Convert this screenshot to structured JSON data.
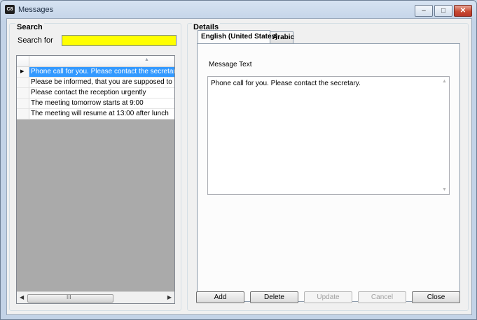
{
  "window": {
    "app_icon_text": "C8",
    "title": "Messages",
    "minimize_glyph": "–",
    "maximize_glyph": "□",
    "close_glyph": "✕"
  },
  "search": {
    "group_label": "Search",
    "field_label": "Search for",
    "value": "",
    "background_color": "#ffff00"
  },
  "grid": {
    "sort_indicator": "▲",
    "rows": [
      {
        "text": "Phone call for you. Please contact the secretary.",
        "selected": true,
        "pointer": "▶"
      },
      {
        "text": "Please be informed, that you are supposed to take c",
        "selected": false,
        "pointer": ""
      },
      {
        "text": "Please contact the reception urgently",
        "selected": false,
        "pointer": ""
      },
      {
        "text": "The meeting tomorrow starts at 9:00",
        "selected": false,
        "pointer": ""
      },
      {
        "text": "The meeting will resume at 13:00 after lunch",
        "selected": false,
        "pointer": ""
      }
    ],
    "scroll_left": "◀",
    "scroll_right": "▶",
    "scroll_grip": "III"
  },
  "details": {
    "group_label": "Details",
    "tabs": [
      {
        "label": "English (United States)",
        "active": true
      },
      {
        "label": "Arabic",
        "active": false
      }
    ],
    "message_label": "Message Text",
    "message_value": "Phone call for you. Please contact the secretary.",
    "scroll_up": "▲",
    "scroll_down": "▼"
  },
  "buttons": {
    "add": "Add",
    "delete": "Delete",
    "update": "Update",
    "cancel": "Cancel",
    "close": "Close"
  },
  "colors": {
    "selection": "#3399ff",
    "search_highlight": "#ffff00"
  }
}
